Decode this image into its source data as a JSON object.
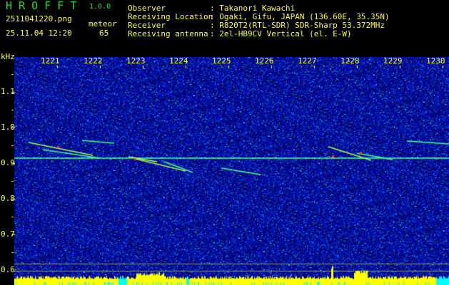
{
  "app": {
    "name": "H R O F F T",
    "version": "1.0.0"
  },
  "file": {
    "name": "2511041220.png",
    "datetime": "25.11.04 12:20"
  },
  "detection": {
    "label": "meteor",
    "count": "65"
  },
  "info": [
    {
      "label": "Observer",
      "value": ": Takanori Kawachi"
    },
    {
      "label": "Receiving Location",
      "value": ": Ogaki, Gifu, JAPAN (136.60E, 35.35N)"
    },
    {
      "label": "Receiver",
      "value": ": R820T2(RTL-SDR) SDR-Sharp 53.372MHz"
    },
    {
      "label": "Receiving antenna",
      "value": ": 2el-HB9CV Vertical (el. E-W)"
    }
  ],
  "y_axis": {
    "unit": "kHz",
    "ticks": [
      "1.1",
      "1.0",
      "0.9",
      "0.8",
      "0.7",
      "0.6"
    ]
  },
  "x_axis": {
    "ticks": [
      "1221",
      "1222",
      "1223",
      "1224",
      "1225",
      "1226",
      "1227",
      "1228",
      "1229",
      "1230"
    ]
  },
  "colors": {
    "text": "#ffff33",
    "title": "#22dd22",
    "background_noise": "#0a1aa0",
    "signal_line": "#33ff66",
    "level_bar": "#ffff00",
    "level_bar_low": "#00ffff"
  }
}
